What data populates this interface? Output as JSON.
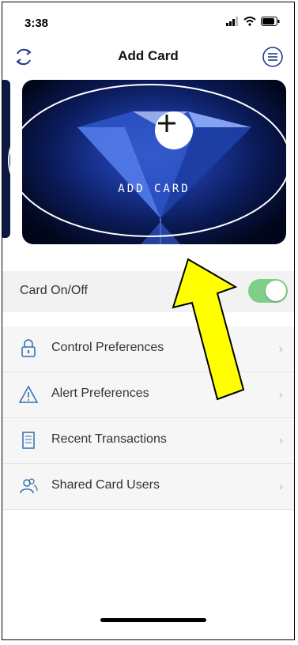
{
  "status_bar": {
    "time": "3:38"
  },
  "nav": {
    "title": "Add Card"
  },
  "card": {
    "label": "ADD CARD"
  },
  "toggle_row": {
    "label": "Card On/Off",
    "on": true
  },
  "menu_items": [
    {
      "label": "Control Preferences",
      "icon": "lock-icon"
    },
    {
      "label": "Alert Preferences",
      "icon": "warning-icon"
    },
    {
      "label": "Recent Transactions",
      "icon": "receipt-icon"
    },
    {
      "label": "Shared Card Users",
      "icon": "users-icon"
    }
  ],
  "colors": {
    "toggle_on": "#7fcf8a",
    "arrow_fill": "#ffff00",
    "card_bg": "#0b1b5a"
  }
}
